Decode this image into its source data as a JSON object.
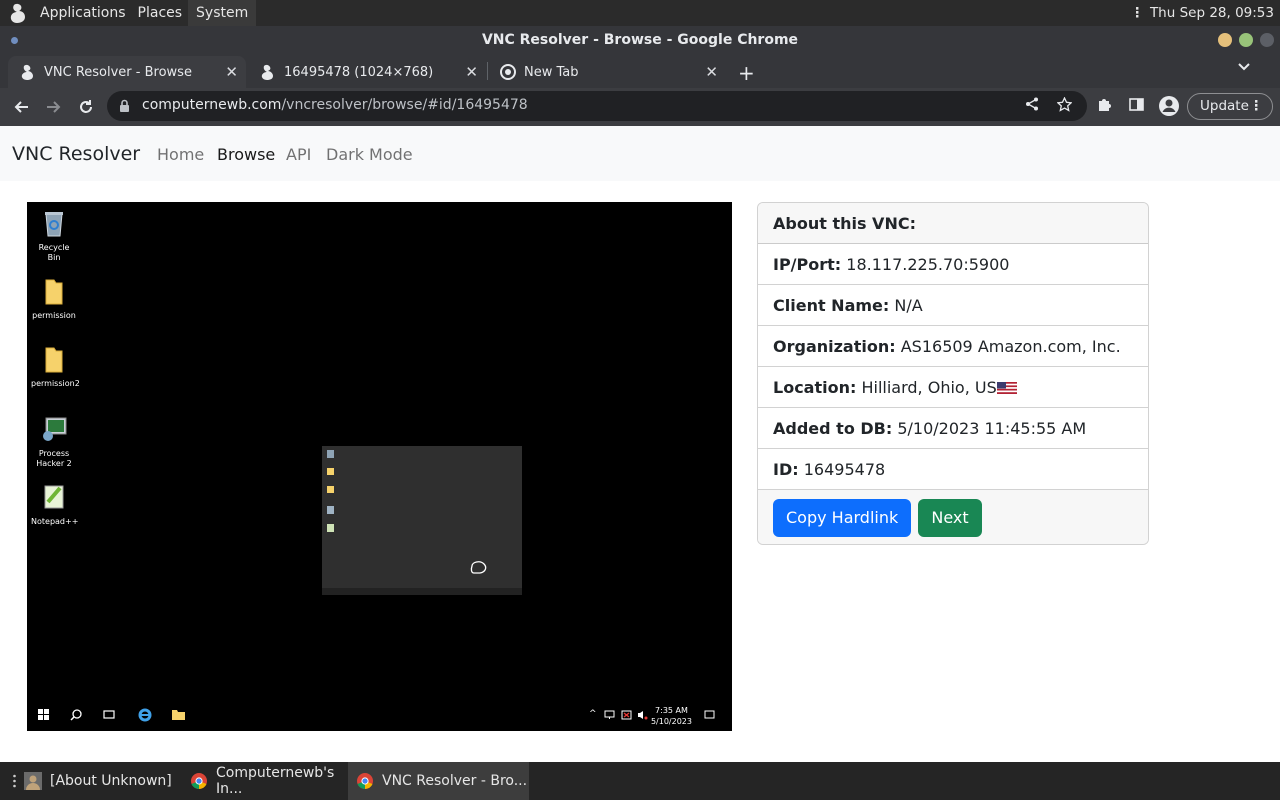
{
  "system_bar": {
    "menus": [
      "Applications",
      "Places",
      "System"
    ],
    "clock": "Thu Sep 28, 09:53"
  },
  "window": {
    "title": "VNC Resolver - Browse - Google Chrome",
    "tabs": [
      {
        "label": "VNC Resolver - Browse",
        "icon": "vnc-resolver-icon",
        "active": true
      },
      {
        "label": "16495478 (1024×768)",
        "icon": "vnc-resolver-icon",
        "active": false
      },
      {
        "label": "New Tab",
        "icon": "chrome-icon",
        "active": false
      }
    ],
    "address": {
      "host": "computernewb.com",
      "path": "/vncresolver/browse/#id/16495478"
    },
    "update_label": "Update"
  },
  "site": {
    "brand": "VNC Resolver",
    "nav": [
      "Home",
      "Browse",
      "API",
      "Dark Mode"
    ],
    "active_nav": "Browse"
  },
  "screenshot": {
    "desktop_icons": [
      "Recycle Bin",
      "permission",
      "permission2",
      "Process Hacker 2",
      "Notepad++"
    ],
    "clock_time": "7:35 AM",
    "clock_date": "5/10/2023"
  },
  "details": {
    "header": "About this VNC:",
    "rows": [
      {
        "label": "IP/Port:",
        "value": "18.117.225.70:5900"
      },
      {
        "label": "Client Name:",
        "value": "N/A"
      },
      {
        "label": "Organization:",
        "value": "AS16509 Amazon.com, Inc."
      },
      {
        "label": "Location:",
        "value": "Hilliard, Ohio, US"
      },
      {
        "label": "Added to DB:",
        "value": "5/10/2023 11:45:55 AM"
      },
      {
        "label": "ID:",
        "value": "16495478"
      }
    ],
    "copy_button": "Copy Hardlink",
    "next_button": "Next"
  },
  "taskbar": {
    "items": [
      {
        "label": "[About Unknown]",
        "icon": "user-icon"
      },
      {
        "label": "Computernewb's In...",
        "icon": "chrome-icon"
      },
      {
        "label": "VNC Resolver - Bro...",
        "icon": "chrome-icon",
        "active": true
      }
    ]
  },
  "colors": {
    "primary": "#0d6efd",
    "success": "#198754",
    "chrome_dark": "#35363a"
  }
}
